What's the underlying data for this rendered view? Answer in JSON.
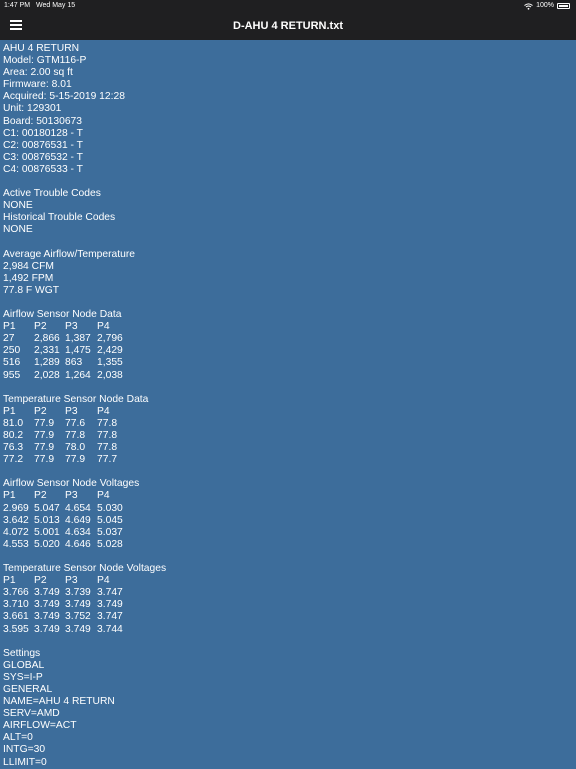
{
  "status_bar": {
    "time": "1:47 PM",
    "date": "Wed May 15",
    "battery": "100%"
  },
  "nav": {
    "title": "D-AHU 4 RETURN.txt"
  },
  "header_lines": [
    "AHU 4 RETURN",
    "Model: GTM116-P",
    "Area: 2.00 sq ft",
    "Firmware: 8.01",
    "Acquired: 5-15-2019 12:28",
    "Unit: 129301",
    "Board: 50130673",
    "C1: 00180128 - T",
    "C2: 00876531 - T",
    "C3: 00876532 - T",
    "C4: 00876533 - T"
  ],
  "trouble_codes": [
    "Active Trouble Codes",
    "NONE",
    "Historical Trouble Codes",
    "NONE"
  ],
  "averages": [
    "Average Airflow/Temperature",
    "2,984 CFM",
    "1,492 FPM",
    "77.8 F WGT"
  ],
  "tables": [
    {
      "title": "Airflow Sensor Node Data",
      "header": [
        "P1",
        "P2",
        "P3",
        "P4"
      ],
      "rows": [
        [
          "27",
          "2,866",
          "1,387",
          "2,796"
        ],
        [
          "250",
          "2,331",
          "1,475",
          "2,429"
        ],
        [
          "516",
          "1,289",
          "863",
          "1,355"
        ],
        [
          "955",
          "2,028",
          "1,264",
          "2,038"
        ]
      ]
    },
    {
      "title": "Temperature Sensor Node Data",
      "header": [
        "P1",
        "P2",
        "P3",
        "P4"
      ],
      "rows": [
        [
          "81.0",
          "77.9",
          "77.6",
          "77.8"
        ],
        [
          "80.2",
          "77.9",
          "77.8",
          "77.8"
        ],
        [
          "76.3",
          "77.9",
          "78.0",
          "77.8"
        ],
        [
          "77.2",
          "77.9",
          "77.9",
          "77.7"
        ]
      ]
    },
    {
      "title": "Airflow Sensor Node Voltages",
      "header": [
        "P1",
        "P2",
        "P3",
        "P4"
      ],
      "rows": [
        [
          "2.969",
          "5.047",
          "4.654",
          "5.030"
        ],
        [
          "3.642",
          "5.013",
          "4.649",
          "5.045"
        ],
        [
          "4.072",
          "5.001",
          "4.634",
          "5.037"
        ],
        [
          "4.553",
          "5.020",
          "4.646",
          "5.028"
        ]
      ]
    },
    {
      "title": "Temperature Sensor Node Voltages",
      "header": [
        "P1",
        "P2",
        "P3",
        "P4"
      ],
      "rows": [
        [
          "3.766",
          "3.749",
          "3.739",
          "3.747"
        ],
        [
          "3.710",
          "3.749",
          "3.749",
          "3.749"
        ],
        [
          "3.661",
          "3.749",
          "3.752",
          "3.747"
        ],
        [
          "3.595",
          "3.749",
          "3.749",
          "3.744"
        ]
      ]
    }
  ],
  "settings": [
    "Settings",
    "GLOBAL",
    "SYS=I-P",
    "GENERAL",
    "NAME=AHU 4 RETURN",
    "SERV=AMD",
    "AIRFLOW=ACT",
    "ALT=0",
    "INTG=30",
    "LLIMIT=0"
  ]
}
